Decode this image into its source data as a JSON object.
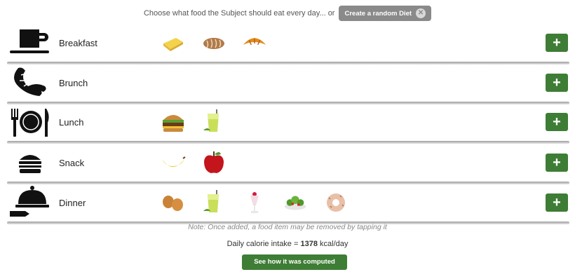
{
  "header": {
    "prompt_text": "Choose what food the Subject should eat every day... or",
    "random_button_label": "Create a random Diet",
    "random_button_close": "✕"
  },
  "meals": [
    {
      "label": "Breakfast",
      "icon": "coffee-cup-icon",
      "foods": [
        "butter-icon",
        "bread-icon",
        "croissant-icon"
      ]
    },
    {
      "label": "Brunch",
      "icon": "croissant-icon",
      "foods": []
    },
    {
      "label": "Lunch",
      "icon": "plate-cutlery-icon",
      "foods": [
        "burger-icon",
        "smoothie-icon"
      ]
    },
    {
      "label": "Snack",
      "icon": "burger-icon",
      "foods": [
        "banana-icon",
        "apple-icon"
      ]
    },
    {
      "label": "Dinner",
      "icon": "cloche-icon",
      "foods": [
        "eggs-icon",
        "smoothie-icon",
        "milkshake-icon",
        "salad-icon",
        "donut-icon"
      ]
    }
  ],
  "add_button_label": "+",
  "note": "Note: Once added, a food item may be removed by tapping it",
  "calorie": {
    "prefix": "Daily calorie intake = ",
    "value": "1378",
    "unit": " kcal/day"
  },
  "computed_button_label": "See how it was computed",
  "colors": {
    "add_button": "#3e7d35",
    "random_button": "#8a8a8a"
  }
}
